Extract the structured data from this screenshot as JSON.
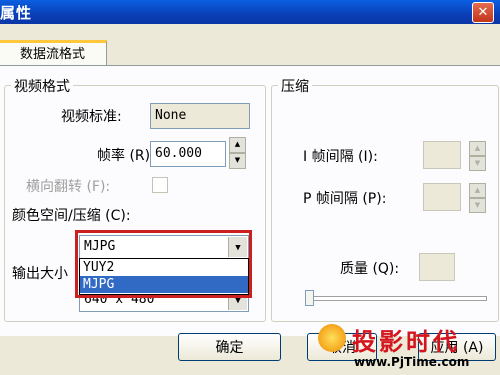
{
  "window": {
    "title": "属性",
    "close_glyph": "✕"
  },
  "tabs": [
    {
      "label": "数据流格式"
    }
  ],
  "video_format": {
    "group_label": "视频格式",
    "standard_label": "视频标准:",
    "standard_value": "None",
    "framerate_label": "帧率 (R):",
    "framerate_value": "60.000",
    "flip_label": "横向翻转 (F):",
    "colorspace_label": "颜色空间/压缩 (C):",
    "colorspace_value": "MJPG",
    "colorspace_options": [
      "YUY2",
      "MJPG"
    ],
    "colorspace_selected": "MJPG",
    "output_size_label": "输出大小",
    "output_size_value": "640 x 480"
  },
  "compression": {
    "group_label": "压缩",
    "i_frame_label": "I 帧间隔 (I):",
    "p_frame_label": "P 帧间隔 (P):",
    "quality_label": "质量 (Q):"
  },
  "buttons": {
    "ok": "确定",
    "cancel": "取消",
    "apply": "应用 (A)"
  },
  "watermark": {
    "text": "投影时代",
    "site": "www.PjTime.com"
  },
  "colors": {
    "highlight": "#316ac5",
    "annotation_box": "#cc1f1f",
    "titlebar": "#0a46c8"
  }
}
